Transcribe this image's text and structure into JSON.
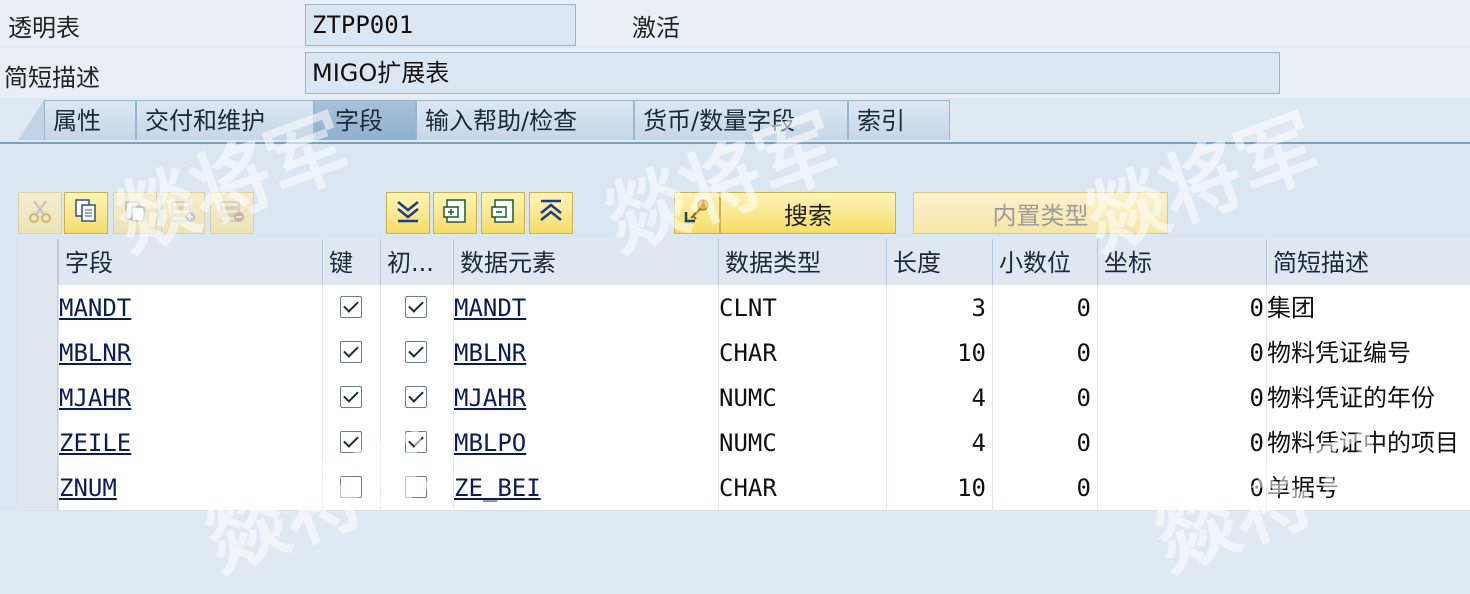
{
  "header": {
    "table_label": "透明表",
    "table_name": "ZTPP001",
    "status": "激活",
    "desc_label": "简短描述",
    "desc_value": "MIGO扩展表"
  },
  "tabs": [
    "属性",
    "交付和维护",
    "字段",
    "输入帮助/检查",
    "货币/数量字段",
    "索引"
  ],
  "active_tab": "字段",
  "toolbar": {
    "icons": [
      "cut-icon",
      "copy-icon",
      "paste-icon",
      "insert-row-icon",
      "delete-row-icon",
      "scroll-bottom-icon",
      "insert-field-icon",
      "delete-field-icon",
      "scroll-top-icon",
      "key-icon"
    ],
    "search_label": "搜索",
    "builtin_type_label": "内置类型"
  },
  "grid": {
    "columns": [
      "字段",
      "键",
      "初...",
      "数据元素",
      "数据类型",
      "长度",
      "小数位",
      "坐标",
      "简短描述"
    ],
    "rows": [
      {
        "field": "MANDT",
        "key": true,
        "init": true,
        "element": "MANDT",
        "type": "CLNT",
        "length": "3",
        "decimals": "0",
        "coord": "0",
        "desc": "集团"
      },
      {
        "field": "MBLNR",
        "key": true,
        "init": true,
        "element": "MBLNR",
        "type": "CHAR",
        "length": "10",
        "decimals": "0",
        "coord": "0",
        "desc": "物料凭证编号"
      },
      {
        "field": "MJAHR",
        "key": true,
        "init": true,
        "element": "MJAHR",
        "type": "NUMC",
        "length": "4",
        "decimals": "0",
        "coord": "0",
        "desc": "物料凭证的年份"
      },
      {
        "field": "ZEILE",
        "key": true,
        "init": true,
        "element": "MBLPO",
        "type": "NUMC",
        "length": "4",
        "decimals": "0",
        "coord": "0",
        "desc": "物料凭证中的项目"
      },
      {
        "field": "ZNUM",
        "key": false,
        "init": false,
        "element": "ZE_BEI",
        "type": "CHAR",
        "length": "10",
        "decimals": "0",
        "coord": "0",
        "desc": "单据号"
      }
    ]
  },
  "watermark": "燚将军",
  "colors": {
    "accent": "#7ea0c0",
    "button": "#f6dd6a",
    "panel": "#dae6f1"
  }
}
